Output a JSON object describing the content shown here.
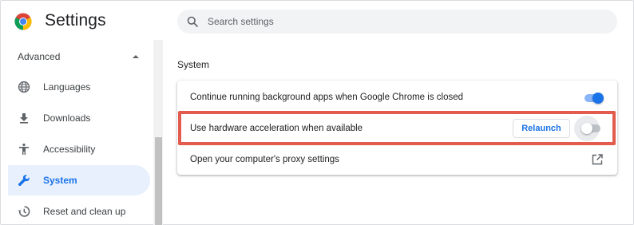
{
  "header": {
    "title": "Settings",
    "logo_icon": "chrome-logo"
  },
  "search": {
    "placeholder": "Search settings",
    "value": ""
  },
  "sidebar": {
    "advanced_label": "Advanced",
    "advanced_expanded": true,
    "items": [
      {
        "label": "Languages",
        "icon": "globe-icon",
        "active": false
      },
      {
        "label": "Downloads",
        "icon": "download-icon",
        "active": false
      },
      {
        "label": "Accessibility",
        "icon": "accessibility-icon",
        "active": false
      },
      {
        "label": "System",
        "icon": "wrench-icon",
        "active": true
      },
      {
        "label": "Reset and clean up",
        "icon": "reset-icon",
        "active": false
      }
    ]
  },
  "main": {
    "section_title": "System",
    "rows": [
      {
        "label": "Continue running background apps when Google Chrome is closed",
        "toggle": "on"
      },
      {
        "label": "Use hardware acceleration when available",
        "button": "Relaunch",
        "toggle": "off"
      },
      {
        "label": "Open your computer's proxy settings",
        "icon": "external-link-icon"
      }
    ]
  },
  "colors": {
    "accent": "#1a73e8",
    "active_bg": "#e8f0fe",
    "highlight_border": "#e25b4c"
  }
}
